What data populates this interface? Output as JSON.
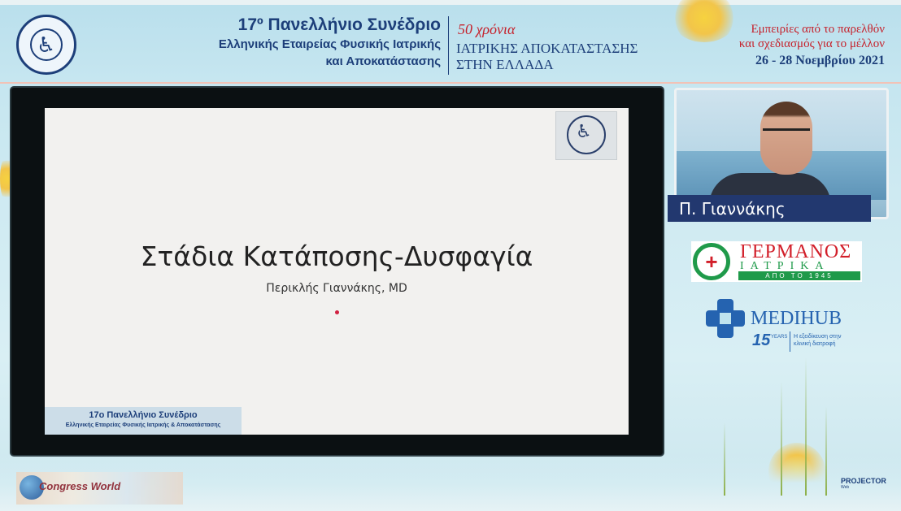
{
  "header": {
    "conference_title": "17º Πανελλήνιο Συνέδριο",
    "society_line1": "Ελληνικής Εταιρείας Φυσικής Ιατρικής",
    "society_line2": "και Αποκατάστασης",
    "anniversary": "50 χρόνια",
    "anniversary_line1": "ΙΑΤΡΙΚΗΣ ΑΠΟΚΑΤΑΣΤΑΣΗΣ",
    "anniversary_line2": "ΣΤΗΝ ΕΛΛΑΔΑ",
    "slogan_line1": "Εμπειρίες από το παρελθόν",
    "slogan_line2": "και σχεδιασμός για το μέλλον",
    "dates": "26 - 28 Νοεμβρίου 2021"
  },
  "slide": {
    "title": "Στάδια Κατάποσης-Δυσφαγία",
    "author": "Περικλής Γιαννάκης, MD",
    "footer_title": "17ο  Πανελλήνιο Συνέδριο",
    "footer_subtitle": "Ελληνικής Εταιρείας Φυσικής Ιατρικής & Αποκατάστασης"
  },
  "speaker": {
    "name": "Π. Γιαννάκης"
  },
  "sponsors": {
    "germanos_name": "ΓΕΡΜΑΝΟΣ",
    "germanos_sub": "ΙΑΤΡΙΚΑ",
    "germanos_since": "ΑΠΟ ΤΟ 1945",
    "medihub_name": "MEDIHUB",
    "medihub_years": "15",
    "medihub_years_label": "YEARS",
    "medihub_tagline": "Η εξειδίκευση στην κλινική διατροφή"
  },
  "footer": {
    "organizer": "Congress World",
    "streaming": "PROJECTOR",
    "streaming_sub": "Web"
  },
  "colors": {
    "brand_blue": "#1d3f7a",
    "brand_red": "#c6202a",
    "name_bar": "#22386f",
    "germanos_green": "#1f9a4a",
    "medihub_blue": "#2563b0"
  }
}
